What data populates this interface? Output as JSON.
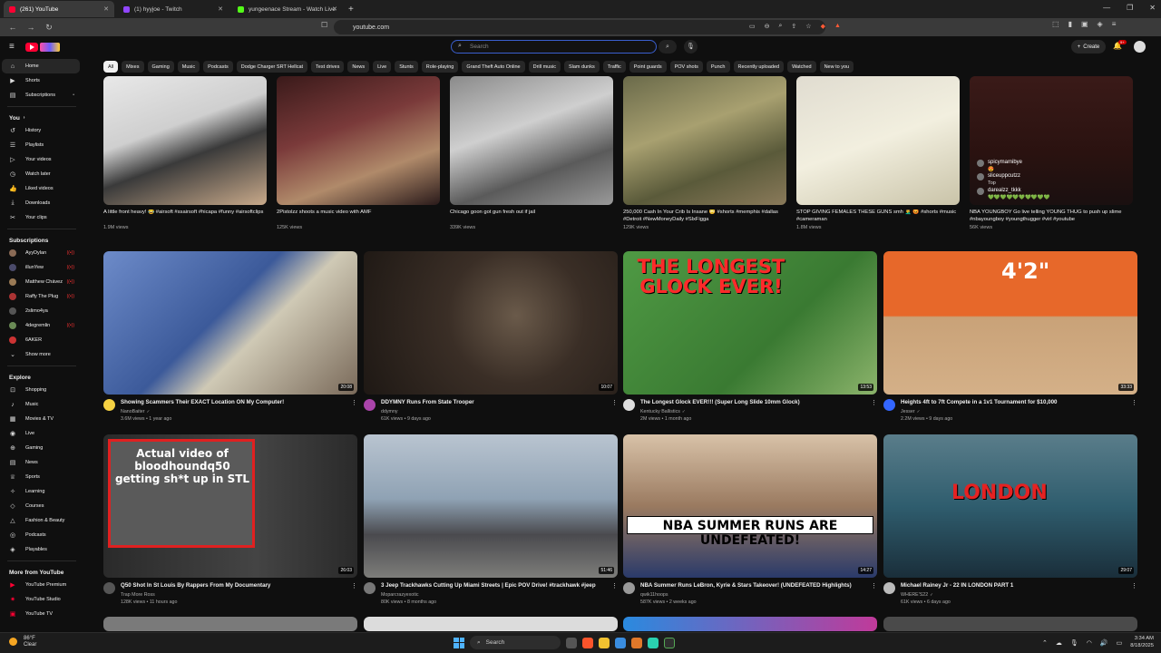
{
  "browser": {
    "tabs": [
      {
        "label": "(261) YouTube",
        "color": "#ff0033"
      },
      {
        "label": "(1) hyyjoe - Twitch",
        "color": "#9146ff"
      },
      {
        "label": "yungeenace Stream - Watch Live",
        "color": "#53fc18"
      }
    ],
    "new_tab": "+",
    "url": "youtube.com"
  },
  "header": {
    "search_placeholder": "Search",
    "create_label": "Create",
    "notif_count": "9+"
  },
  "sidebar": {
    "main": [
      {
        "label": "Home",
        "icon": "home-icon"
      },
      {
        "label": "Shorts",
        "icon": "shorts-icon"
      },
      {
        "label": "Subscriptions",
        "icon": "subscriptions-icon"
      }
    ],
    "you_heading": "You",
    "you": [
      {
        "label": "History"
      },
      {
        "label": "Playlists"
      },
      {
        "label": "Your videos"
      },
      {
        "label": "Watch later"
      },
      {
        "label": "Liked videos"
      },
      {
        "label": "Downloads"
      },
      {
        "label": "Your clips"
      }
    ],
    "subs_heading": "Subscriptions",
    "subs": [
      {
        "label": "AyyDylan",
        "live": "((•))"
      },
      {
        "label": "illunYew",
        "live": "((•))"
      },
      {
        "label": "Matthew Chávez",
        "live": "((•))"
      },
      {
        "label": "Raffy The Plug",
        "live": "((•))"
      },
      {
        "label": "2slimo4ya",
        "live": ""
      },
      {
        "label": "4degremlin",
        "live": "((•))"
      },
      {
        "label": "6AKER",
        "live": ""
      }
    ],
    "show_more": "Show more",
    "explore_heading": "Explore",
    "explore": [
      {
        "label": "Shopping"
      },
      {
        "label": "Music"
      },
      {
        "label": "Movies & TV"
      },
      {
        "label": "Live"
      },
      {
        "label": "Gaming"
      },
      {
        "label": "News"
      },
      {
        "label": "Sports"
      },
      {
        "label": "Learning"
      },
      {
        "label": "Courses"
      },
      {
        "label": "Fashion & Beauty"
      },
      {
        "label": "Podcasts"
      },
      {
        "label": "Playables"
      }
    ],
    "more_heading": "More from YouTube",
    "more": [
      {
        "label": "YouTube Premium"
      },
      {
        "label": "YouTube Studio"
      },
      {
        "label": "YouTube TV"
      }
    ]
  },
  "chips": [
    "All",
    "Mixes",
    "Gaming",
    "Music",
    "Podcasts",
    "Dodge Charger SRT Hellcat",
    "Test drives",
    "News",
    "Live",
    "Stunts",
    "Role-playing",
    "Grand Theft Auto Online",
    "Drill music",
    "Slam dunks",
    "Traffic",
    "Point guards",
    "POV shots",
    "Punch",
    "Recently uploaded",
    "Watched",
    "New to you"
  ],
  "shorts": [
    {
      "title": "A little front heavy! 😂 #airsoft #ssairsoft #hicapa #funny #airsoftclips",
      "views": "1.9M views"
    },
    {
      "title": "2Pistolzz shoots a music video with AMF",
      "views": "125K views"
    },
    {
      "title": "Chicago goon got gun fresh out if jail",
      "views": "339K views"
    },
    {
      "title": "250,000 Cash In Your Crib Is Insane 😳 #shorts #memphis #dallas #Detroit #NewMoneyDaily #SlxFigga",
      "views": "129K views"
    },
    {
      "title": "STOP GIVING FEMALES THESE GUNS smh 🤦‍♂️ 😡 #shorts #music #cameraman",
      "views": "1.8M views"
    },
    {
      "title": "NBA YOUNGBOY Go live telling YOUNG THUG to push up slime #nbayoungboy #youngthugger #virl #youtube",
      "views": "56K views"
    }
  ],
  "live_chat": [
    {
      "user": "spicymamibye",
      "sub": "😍"
    },
    {
      "user": "sliceuppcutzz",
      "sub": "Top"
    },
    {
      "user": "darealzz_tkkk",
      "sub": "💚💚💚💚💚💚💚💚💚💚"
    }
  ],
  "videos": [
    {
      "title": "Showing Scammers Their EXACT Location ON My Computer!",
      "channel": "NanoBaiter",
      "verified": "✓",
      "stats": "3.6M views • 1 year ago",
      "duration": "20:08",
      "avatar": "#f5d142",
      "thumb_text": "",
      "bg": "#5a7ab5"
    },
    {
      "title": "DDYMNY Runs From State Trooper",
      "channel": "ddymny",
      "verified": "",
      "stats": "61K views • 9 days ago",
      "duration": "10:07",
      "avatar": "#aa44aa",
      "thumb_text": "",
      "bg": "#2a221d"
    },
    {
      "title": "The Longest Glock EVER!!! (Super Long Slide 10mm Glock)",
      "channel": "Kentucky Ballistics",
      "verified": "✓",
      "stats": "2M views • 1 month ago",
      "duration": "13:53",
      "avatar": "#dddddd",
      "thumb_text": "THE LONGEST GLOCK EVER!",
      "bg": "#3f8a3a"
    },
    {
      "title": "Heights 4ft to 7ft Compete in a 1v1 Tournament for $10,000",
      "channel": "Jesser",
      "verified": "✓",
      "stats": "2.2M views • 9 days ago",
      "duration": "33:33",
      "avatar": "#3366ff",
      "thumb_text": "4'2\"",
      "bg": "#e7682a"
    },
    {
      "title": "Q50 Shot In St Louis By Rappers From My Documentary",
      "channel": "Trap More Ross",
      "verified": "",
      "stats": "128K views • 11 hours ago",
      "duration": "26:03",
      "avatar": "#555555",
      "thumb_text": "Actual video of bloodhoundq50 getting sh*t up in STL",
      "bg": "#3a3a3a"
    },
    {
      "title": "3 Jeep Trackhawks Cutting Up Miami Streets | Epic POV Drive! #trackhawk #jeep",
      "channel": "Moparcrazyexotic",
      "verified": "",
      "stats": "80K views • 8 months ago",
      "duration": "51:46",
      "avatar": "#777777",
      "thumb_text": "",
      "bg": "#8aa0b5"
    },
    {
      "title": "NBA Summer Runs LeBron, Kyrie & Stars Takeover! (UNDEFEATED Highlights)",
      "channel": "qwik11hoops",
      "verified": "",
      "stats": "587K views • 2 weeks ago",
      "duration": "14:27",
      "avatar": "#999999",
      "thumb_text": "NBA SUMMER RUNS ARE UNDEFEATED!",
      "bg": "#c9a584"
    },
    {
      "title": "Michael Rainey Jr - 22 IN LONDON PART 1",
      "channel": "WHERE'S22",
      "verified": "✓",
      "stats": "61K views • 6 days ago",
      "duration": "29:07",
      "avatar": "#bbbbbb",
      "thumb_text": "LONDON",
      "bg": "#2f5d6e"
    }
  ],
  "taskbar": {
    "temp": "86°F",
    "condition": "Clear",
    "search": "Search",
    "time": "3:34 AM",
    "date": "8/18/2025"
  }
}
